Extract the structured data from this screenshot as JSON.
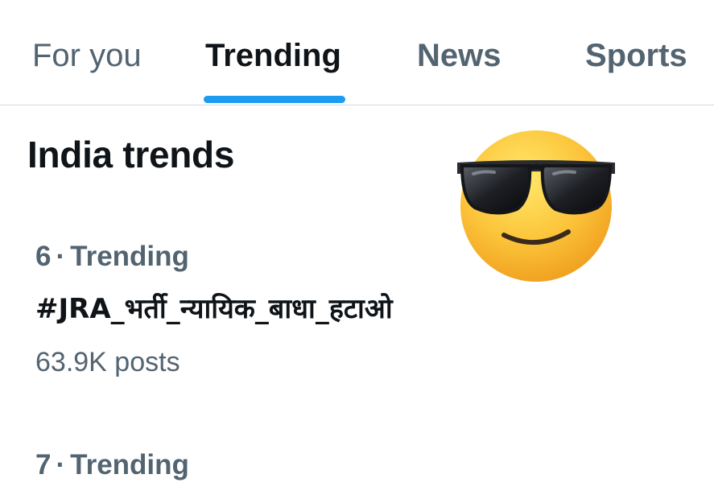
{
  "tabs": [
    {
      "label": "For you",
      "active": false
    },
    {
      "label": "Trending",
      "active": true
    },
    {
      "label": "News",
      "active": false
    },
    {
      "label": "Sports",
      "active": false
    }
  ],
  "section": {
    "title": "India trends"
  },
  "trends": [
    {
      "rank": "6",
      "separator": "·",
      "category": "Trending",
      "name": "#JRA_भर्ती_न्यायिक_बाधा_हटाओ",
      "posts": "63.9K posts"
    },
    {
      "rank": "7",
      "separator": "·",
      "category": "Trending"
    }
  ],
  "decoration": {
    "emoji_icon": "smiling-face-with-sunglasses-icon"
  },
  "colors": {
    "accent": "#1d9bf0",
    "primary_text": "#0f1419",
    "secondary_text": "#536471",
    "divider": "#d6dadd"
  }
}
